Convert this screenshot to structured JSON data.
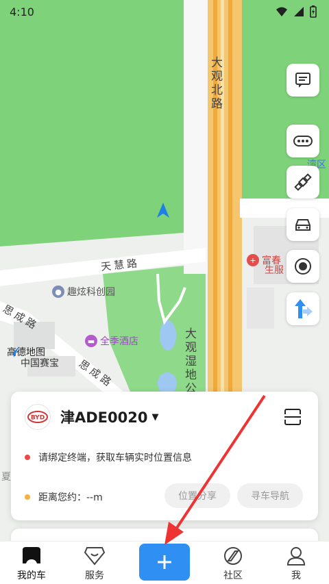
{
  "status_bar": {
    "time": "4:10"
  },
  "map": {
    "roads": {
      "dagan_north": "大观北路",
      "tianhui": "天慧路",
      "siche_upper": "思成路",
      "siche_lower": "思成路",
      "daguan_shidi": "大观湿地公"
    },
    "pois": {
      "quxuan": "趣炫科创园",
      "quanji": "全季酒店",
      "fuchun": "富春",
      "fuchun2": "生服",
      "china_tree": "中国赛宝",
      "edge_top": "湾区",
      "xia": "夏"
    },
    "gaode_logo": "高德地图",
    "colors": {
      "green": "#7ed37a",
      "road": "#ffffff",
      "highway": "#f4b44a"
    }
  },
  "tools": [
    {
      "icon": "message-icon"
    },
    {
      "icon": "more-icon"
    },
    {
      "icon": "satellite-icon"
    },
    {
      "icon": "car-icon"
    },
    {
      "icon": "location-icon"
    },
    {
      "icon": "navigation-icon"
    }
  ],
  "vehicle_card": {
    "brand": "BYD",
    "plate": "津ADE0020",
    "bind_notice": "请绑定终端，获取车辆实时位置信息",
    "distance_label": "距离您约：",
    "distance_value": "--m",
    "share_button": "位置分享",
    "navigate_button": "寻车导航",
    "colors": {
      "red_dot": "#f04848",
      "orange_dot": "#f5b23c"
    }
  },
  "bottom_nav": {
    "items": [
      {
        "label": "我的车",
        "icon": "car-face-icon",
        "active": true
      },
      {
        "label": "服务",
        "icon": "heart-diamond-icon",
        "active": false
      },
      {
        "label": "社区",
        "icon": "compass-icon",
        "active": false
      },
      {
        "label": "我",
        "icon": "person-icon",
        "active": false
      }
    ],
    "accent": "#2f8ff2"
  }
}
